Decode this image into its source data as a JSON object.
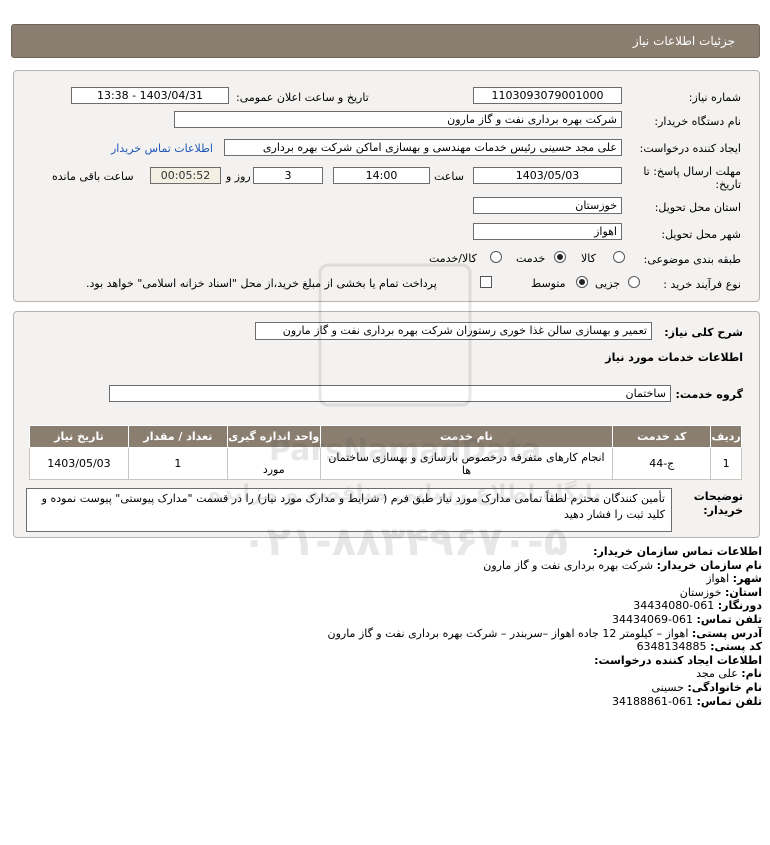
{
  "header": {
    "title": "جزئیات اطلاعات نیاز"
  },
  "form": {
    "need_number_label": "شماره نیاز:",
    "need_number": "1103093079001000",
    "announce_label": "تاریخ و ساعت اعلان عمومی:",
    "announce_value": "1403/04/31 - 13:38",
    "buyer_org_label": "نام دستگاه خریدار:",
    "buyer_org": "شرکت بهره برداری نفت و گاز مارون",
    "creator_label": "ایجاد کننده درخواست:",
    "creator": "علی مجد حسینی رئیس خدمات مهندسی و بهسازی اماکن شرکت بهره برداری",
    "contact_link": "اطلاعات تماس خریدار",
    "deadline_label": "مهلت ارسال پاسخ: تا",
    "deadline_label2": "تاریخ:",
    "deadline_date": "1403/05/03",
    "time_label": "ساعت",
    "deadline_time": "14:00",
    "days_value": "3",
    "days_label": "روز و",
    "remaining_time": "00:05:52",
    "remaining_label": "ساعت باقی مانده",
    "province_label": "استان محل تحویل:",
    "province": "خوزستان",
    "city_label": "شهر محل تحویل:",
    "city": "اهواز",
    "category_label": "طبقه بندی موضوعی:",
    "category_options": [
      "کالا",
      "خدمت",
      "کالا/خدمت"
    ],
    "category_selected": "خدمت",
    "process_label": "نوع فرآیند خرید :",
    "process_options": [
      "جزیی",
      "متوسط"
    ],
    "process_selected": "متوسط",
    "payment_note": "پرداخت تمام یا بخشی از مبلغ خرید،از محل \"اسناد خزانه اسلامی\" خواهد بود."
  },
  "detail": {
    "summary_label": "شرح کلی نیاز:",
    "summary": "تعمیر و بهسازی سالن غذا خوری رستوران شرکت بهره برداری نفت و گاز مارون",
    "services_heading": "اطلاعات خدمات مورد نیاز",
    "group_label": "گروه خدمت:",
    "group_value": "ساختمان",
    "table": {
      "headers": [
        "ردیف",
        "کد خدمت",
        "نام خدمت",
        "واحد اندازه گیری",
        "تعداد / مقدار",
        "تاریخ نیاز"
      ],
      "rows": [
        [
          "1",
          "ج-44",
          "انجام کارهای متفرقه درخصوص بازسازی و بهسازی ساختمان ها",
          "مورد",
          "1",
          "1403/05/03"
        ]
      ]
    },
    "buyer_notes_label": "توضیحات خریدار:",
    "buyer_notes": "تأمین کنندگان محترم لطفاً تمامی مدارک مورد نیاز طبق فرم ( شرایط و مدارک مورد نیاز) را در قسمت \"مدارک پیوستی\" پیوست نموده و کلید ثبت را فشار دهید"
  },
  "contact": {
    "org_heading": "اطلاعات تماس سازمان خریدار:",
    "org_name_label": "نام سازمان خریدار:",
    "org_name": "شرکت بهره برداری نفت و گاز مارون",
    "city_label": "شهر:",
    "city": "اهواز",
    "province_label": "استان:",
    "province": "خوزستان",
    "fax_label": "دورنگار:",
    "fax": "061-34434080",
    "phone_label": "تلفن تماس:",
    "phone": "061-34434069",
    "address_label": "آدرس پستی:",
    "address": "اهواز – کیلومتر 12 جاده اهواز –سربندر – شرکت بهره برداری نفت و گاز مارون",
    "postal_label": "کد پستی:",
    "postal": "6348134885",
    "creator_heading": "اطلاعات ایجاد کننده درخواست:",
    "first_name_label": "نام:",
    "first_name": "علی مجد",
    "last_name_label": "نام خانوادگی:",
    "last_name": "حسینی",
    "creator_phone_label": "تلفن تماس:",
    "creator_phone": "061-34188861"
  },
  "watermark": {
    "brand": "ParsNamadData",
    "line1": "پایگاه اطلاع رسانی مناقصه و مزایده",
    "phone": "۰۲۱-۸۸۳۴۹۶۷۰-۵"
  },
  "colors": {
    "header_bg": "#8a7e70",
    "panel_bg": "#f3f2f0",
    "link": "#1f56b8",
    "timer_bg": "#f3efe2"
  }
}
